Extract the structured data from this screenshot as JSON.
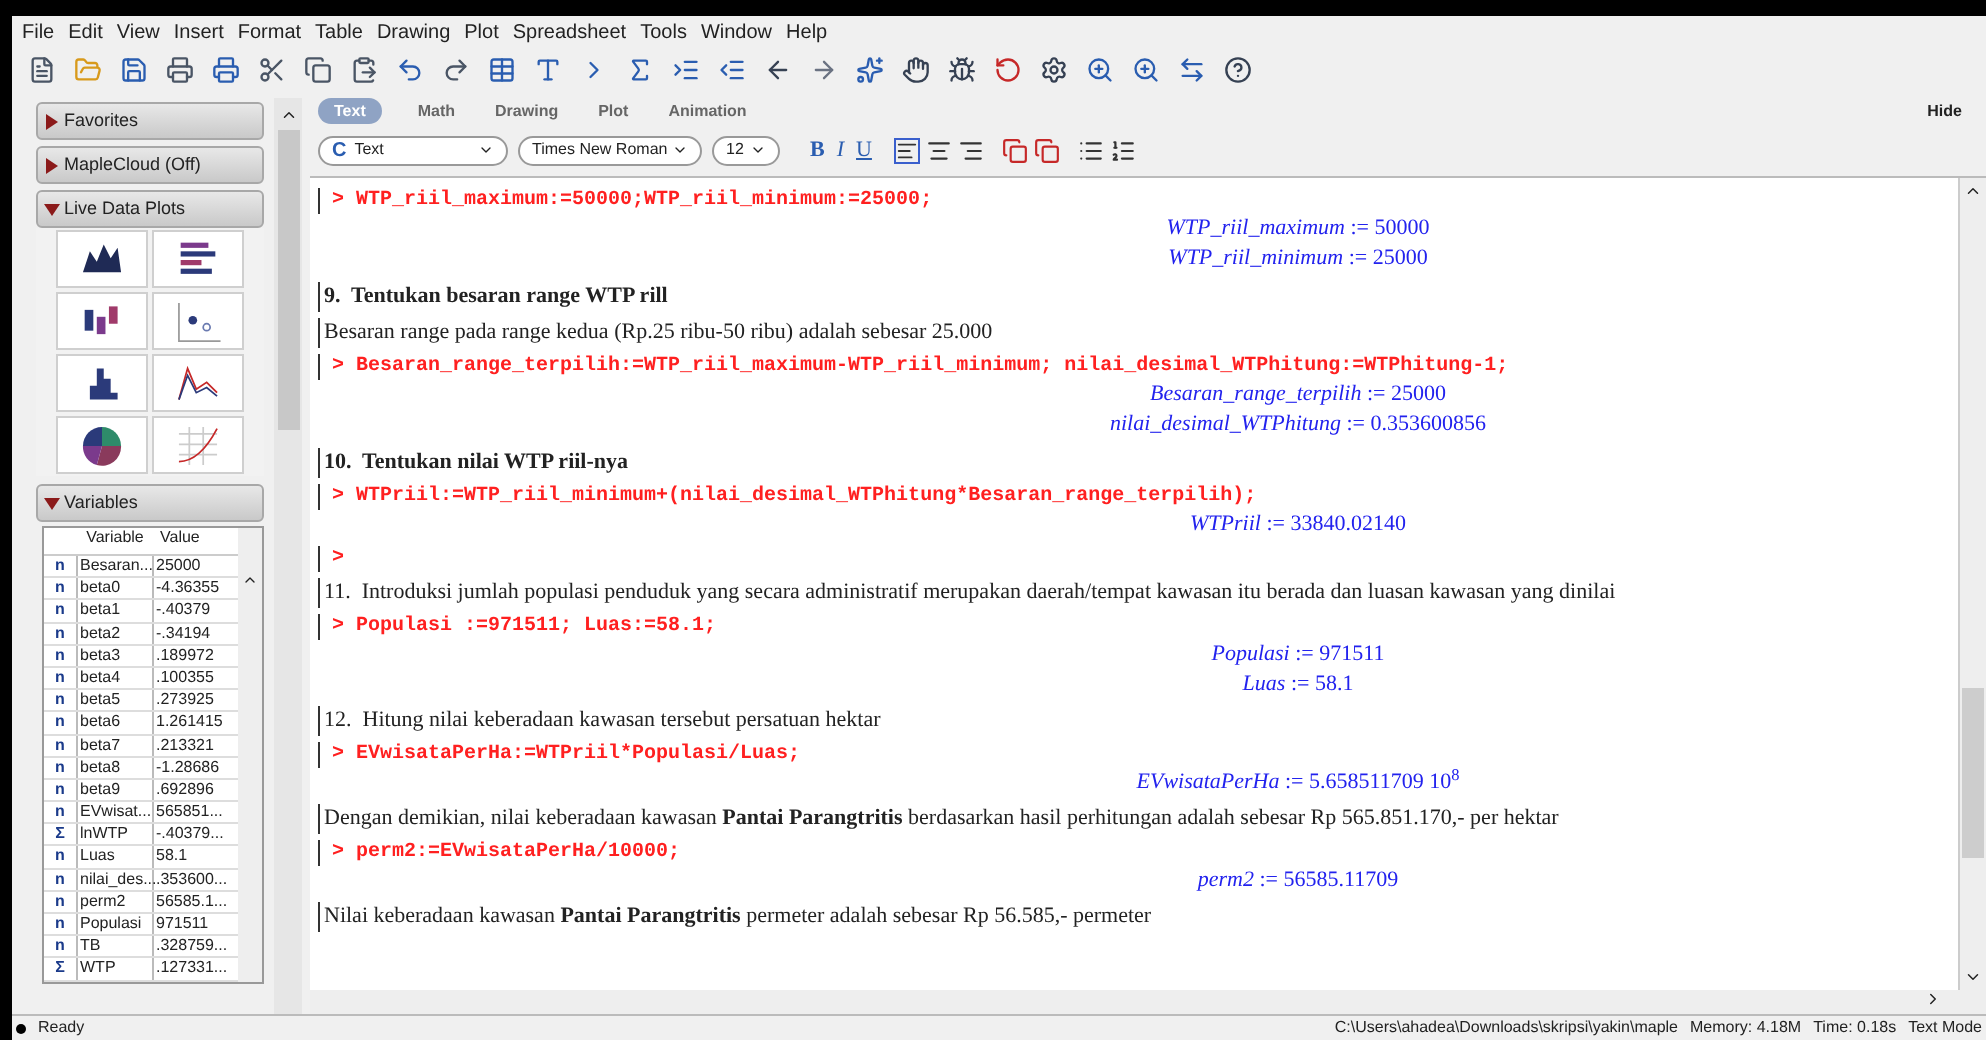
{
  "menu": [
    "File",
    "Edit",
    "View",
    "Insert",
    "Format",
    "Table",
    "Drawing",
    "Plot",
    "Spreadsheet",
    "Tools",
    "Window",
    "Help"
  ],
  "palettes": [
    {
      "label": "Favorites",
      "expanded": false
    },
    {
      "label": "MapleCloud (Off)",
      "expanded": false
    },
    {
      "label": "Live Data Plots",
      "expanded": true
    }
  ],
  "variables": {
    "title": "Variables",
    "expanded": true,
    "columns": [
      "Variable",
      "Value"
    ],
    "rows": [
      {
        "type": "n",
        "name": "Besaran...",
        "value": "25000"
      },
      {
        "type": "n",
        "name": "beta0",
        "value": "-4.36355"
      },
      {
        "type": "n",
        "name": "beta1",
        "value": "-.40379"
      },
      {
        "type": "n",
        "name": "beta2",
        "value": "-.34194"
      },
      {
        "type": "n",
        "name": "beta3",
        "value": ".189972"
      },
      {
        "type": "n",
        "name": "beta4",
        "value": ".100355"
      },
      {
        "type": "n",
        "name": "beta5",
        "value": ".273925"
      },
      {
        "type": "n",
        "name": "beta6",
        "value": "1.261415"
      },
      {
        "type": "n",
        "name": "beta7",
        "value": ".213321"
      },
      {
        "type": "n",
        "name": "beta8",
        "value": "-1.28686"
      },
      {
        "type": "n",
        "name": "beta9",
        "value": ".692896"
      },
      {
        "type": "n",
        "name": "EVwisat...",
        "value": "565851..."
      },
      {
        "type": "Σ",
        "name": "lnWTP",
        "value": "-.40379..."
      },
      {
        "type": "n",
        "name": "Luas",
        "value": "58.1"
      },
      {
        "type": "n",
        "name": "nilai_des...",
        "value": ".353600..."
      },
      {
        "type": "n",
        "name": "perm2",
        "value": "56585.1..."
      },
      {
        "type": "n",
        "name": "Populasi",
        "value": "971511"
      },
      {
        "type": "n",
        "name": "TB",
        "value": ".328759..."
      },
      {
        "type": "Σ",
        "name": "WTP",
        "value": ".127331..."
      }
    ]
  },
  "context_tabs": [
    {
      "label": "Text",
      "selected": true
    },
    {
      "label": "Math",
      "selected": false
    },
    {
      "label": "Drawing",
      "selected": false
    },
    {
      "label": "Plot",
      "selected": false
    },
    {
      "label": "Animation",
      "selected": false
    }
  ],
  "hide_label": "Hide",
  "style_select_icon": "C",
  "style_select": "Text",
  "font_select": "Times New Roman",
  "size_select": "12",
  "format_buttons": [
    {
      "label": "B",
      "kind": "bold"
    },
    {
      "label": "I",
      "kind": "italic"
    },
    {
      "label": "U",
      "kind": "underline"
    }
  ],
  "document": [
    {
      "kind": "input",
      "prompt": ">",
      "text": "WTP_riil_maximum:=50000;WTP_riil_minimum:=25000;"
    },
    {
      "kind": "output",
      "name": "WTP_riil_maximum",
      "value": ":= 50000"
    },
    {
      "kind": "output",
      "name": "WTP_riil_minimum",
      "value": ":= 25000"
    },
    {
      "kind": "heading",
      "text": "9.  Tentukan besaran range WTP rill"
    },
    {
      "kind": "text",
      "text": "Besaran range pada range kedua (Rp.25 ribu-50 ribu) adalah sebesar 25.000"
    },
    {
      "kind": "input",
      "prompt": ">",
      "text": "Besaran_range_terpilih:=WTP_riil_maximum-WTP_riil_minimum; nilai_desimal_WTPhitung:=WTPhitung-1;"
    },
    {
      "kind": "output",
      "name": "Besaran_range_terpilih",
      "value": ":= 25000"
    },
    {
      "kind": "output",
      "name": "nilai_desimal_WTPhitung",
      "value": ":= 0.353600856"
    },
    {
      "kind": "heading",
      "text": "10.  Tentukan nilai WTP riil-nya"
    },
    {
      "kind": "input",
      "prompt": ">",
      "text": "WTPriil:=WTP_riil_minimum+(nilai_desimal_WTPhitung*Besaran_range_terpilih);"
    },
    {
      "kind": "output",
      "name": "WTPriil",
      "value": ":= 33840.02140"
    },
    {
      "kind": "input",
      "prompt": ">"
    },
    {
      "kind": "text",
      "text": "11.  Introduksi jumlah populasi penduduk yang secara administratif merupakan daerah/tempat kawasan itu berada dan luasan kawasan yang dinilai"
    },
    {
      "kind": "input",
      "prompt": ">",
      "text": "Populasi :=971511; Luas:=58.1;"
    },
    {
      "kind": "output",
      "name": "Populasi",
      "value": ":= 971511"
    },
    {
      "kind": "output",
      "name": "Luas",
      "value": ":= 58.1"
    },
    {
      "kind": "text",
      "text": "12.  Hitung nilai keberadaan kawasan tersebut persatuan hektar"
    },
    {
      "kind": "input",
      "prompt": ">",
      "text": "EVwisataPerHa:=WTPriil*Populasi/Luas;"
    },
    {
      "kind": "output",
      "name": "EVwisataPerHa",
      "value": ":= 5.658511709 10$^{8}$"
    },
    {
      "kind": "text",
      "text": "Dengan demikian, nilai keberadaan kawasan **Pantai Parangtritis** berdasarkan hasil perhitungan adalah sebesar Rp 565.851.170,- per hektar"
    },
    {
      "kind": "input",
      "prompt": ">",
      "text": "perm2:=EVwisataPerHa/10000;"
    },
    {
      "kind": "output",
      "name": "perm2",
      "value": ":= 56585.11709"
    },
    {
      "kind": "text",
      "text": "Nilai keberadaan kawasan **Pantai Parangtritis** permeter adalah sebesar Rp 56.585,- permeter"
    }
  ],
  "status_bar": {
    "state": "Ready",
    "path": "C:\\Users\\ahadea\\Downloads\\skripsi\\yakin\\maple",
    "memory": "Memory: 4.18M",
    "time": "Time: 0.18s",
    "mode": "Text Mode"
  }
}
